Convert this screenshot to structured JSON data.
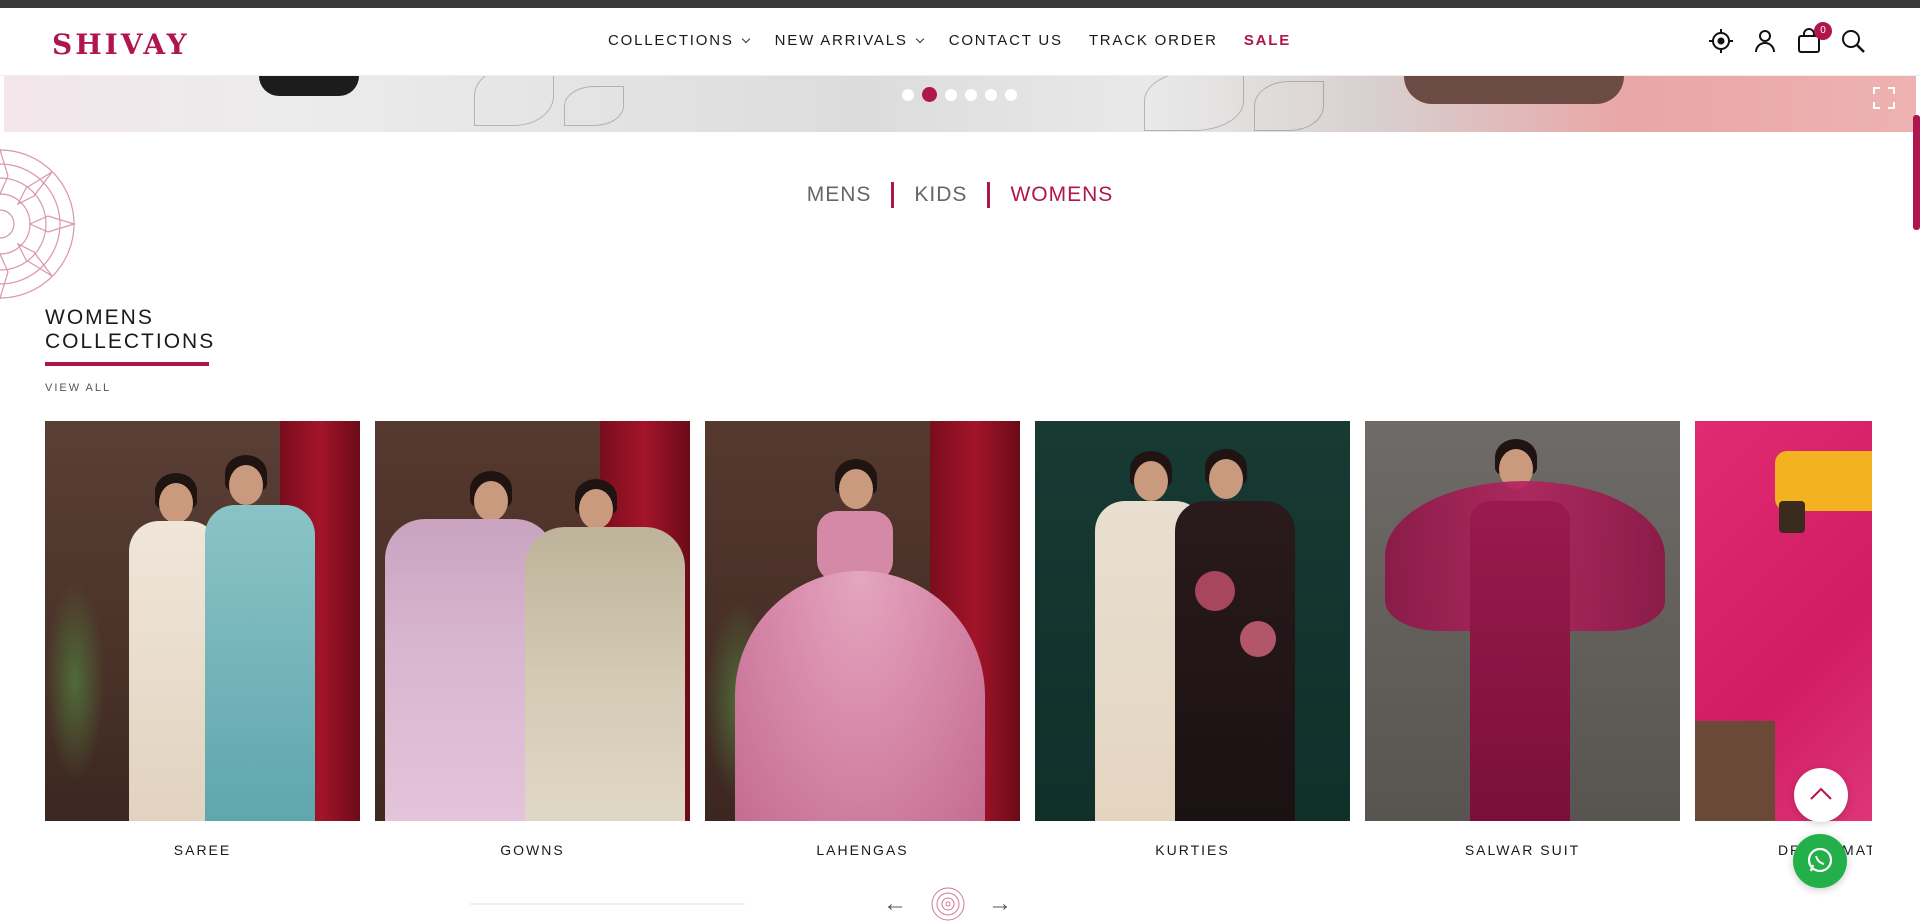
{
  "brand": {
    "logo_text": "SHIVAY",
    "accent_color": "#b0154f"
  },
  "nav": {
    "items": [
      {
        "label": "COLLECTIONS",
        "has_dropdown": true
      },
      {
        "label": "NEW ARRIVALS",
        "has_dropdown": true
      },
      {
        "label": "CONTACT US",
        "has_dropdown": false
      },
      {
        "label": "TRACK ORDER",
        "has_dropdown": false
      },
      {
        "label": "SALE",
        "has_dropdown": false
      }
    ]
  },
  "header_icons": {
    "location": "location-icon",
    "account": "user-icon",
    "cart": "shopping-bag-icon",
    "cart_count": "0",
    "search": "search-icon"
  },
  "banner": {
    "slide_count": 6,
    "active_slide": 2,
    "expand": "expand-icon"
  },
  "category_tabs": [
    "MENS",
    "KIDS",
    "WOMENS"
  ],
  "active_tab": "WOMENS",
  "section": {
    "title_line1": "WOMENS",
    "title_line2": "COLLECTIONS",
    "view_all": "VIEW ALL"
  },
  "products": [
    {
      "label": "SAREE"
    },
    {
      "label": "GOWNS"
    },
    {
      "label": "LAHENGAS"
    },
    {
      "label": "KURTIES"
    },
    {
      "label": "SALWAR SUIT"
    },
    {
      "label": "DRESS MATERIAL"
    }
  ],
  "carousel_nav": {
    "prev": "←",
    "next": "→"
  },
  "floating": {
    "scroll_top": "chevron-up-icon",
    "whatsapp": "whatsapp-icon"
  }
}
